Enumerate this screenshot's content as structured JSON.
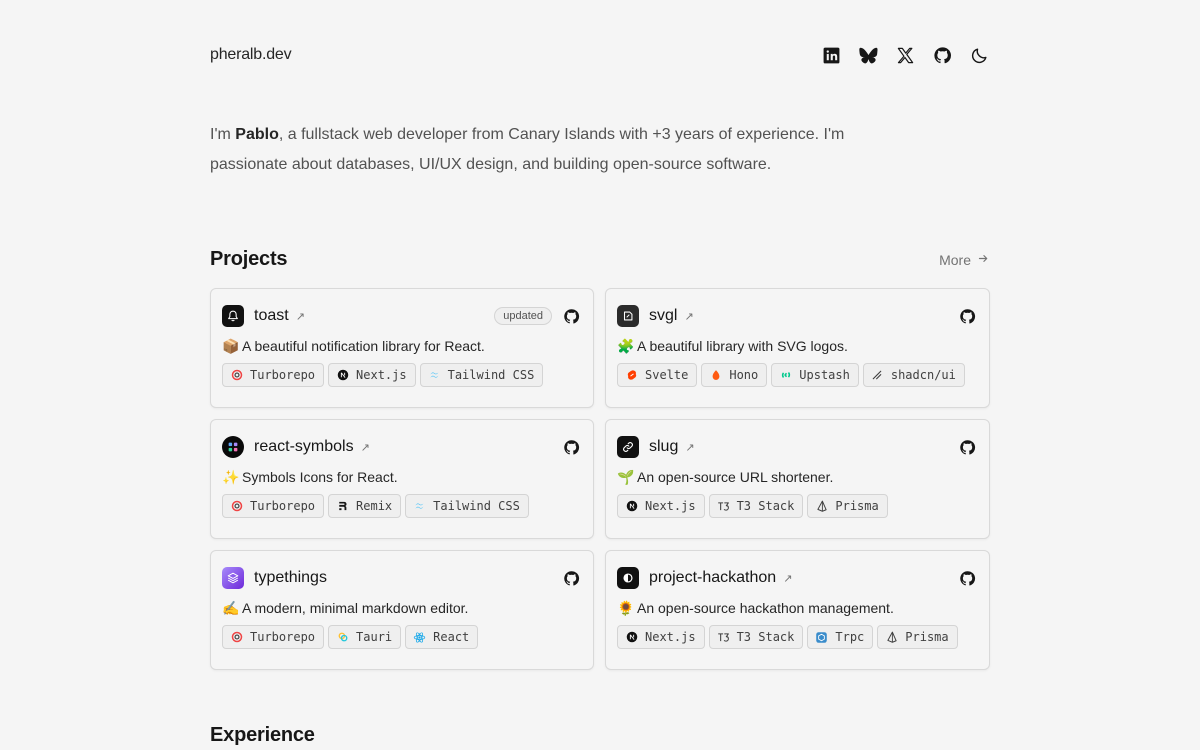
{
  "header": {
    "site_title": "pheralb.dev",
    "social": [
      "linkedin-icon",
      "bluesky-icon",
      "x-icon",
      "github-icon",
      "dark-mode-icon"
    ]
  },
  "intro": {
    "prefix": "I'm ",
    "name": "Pablo",
    "suffix": ", a fullstack web developer from Canary Islands with +3 years of experience. I'm passionate about databases, UI/UX design, and building open-source software."
  },
  "projects": {
    "title": "Projects",
    "more_label": "More",
    "items": [
      {
        "name": "toast",
        "badge": "updated",
        "emoji": "📦",
        "description": "A beautiful notification library for React.",
        "tags": [
          "Turborepo",
          "Next.js",
          "Tailwind CSS"
        ]
      },
      {
        "name": "svgl",
        "badge": "",
        "emoji": "🧩",
        "description": "A beautiful library with SVG logos.",
        "tags": [
          "Svelte",
          "Hono",
          "Upstash",
          "shadcn/ui"
        ]
      },
      {
        "name": "react-symbols",
        "badge": "",
        "emoji": "✨",
        "description": "Symbols Icons for React.",
        "tags": [
          "Turborepo",
          "Remix",
          "Tailwind CSS"
        ]
      },
      {
        "name": "slug",
        "badge": "",
        "emoji": "🌱",
        "description": "An open-source URL shortener.",
        "tags": [
          "Next.js",
          "T3 Stack",
          "Prisma"
        ]
      },
      {
        "name": "typethings",
        "badge": "",
        "emoji": "✍️",
        "description": "A modern, minimal markdown editor.",
        "tags": [
          "Turborepo",
          "Tauri",
          "React"
        ]
      },
      {
        "name": "project-hackathon",
        "badge": "",
        "emoji": "🌻",
        "description": "An open-source hackathon management.",
        "tags": [
          "Next.js",
          "T3 Stack",
          "Trpc",
          "Prisma"
        ]
      }
    ]
  },
  "experience": {
    "title": "Experience"
  }
}
